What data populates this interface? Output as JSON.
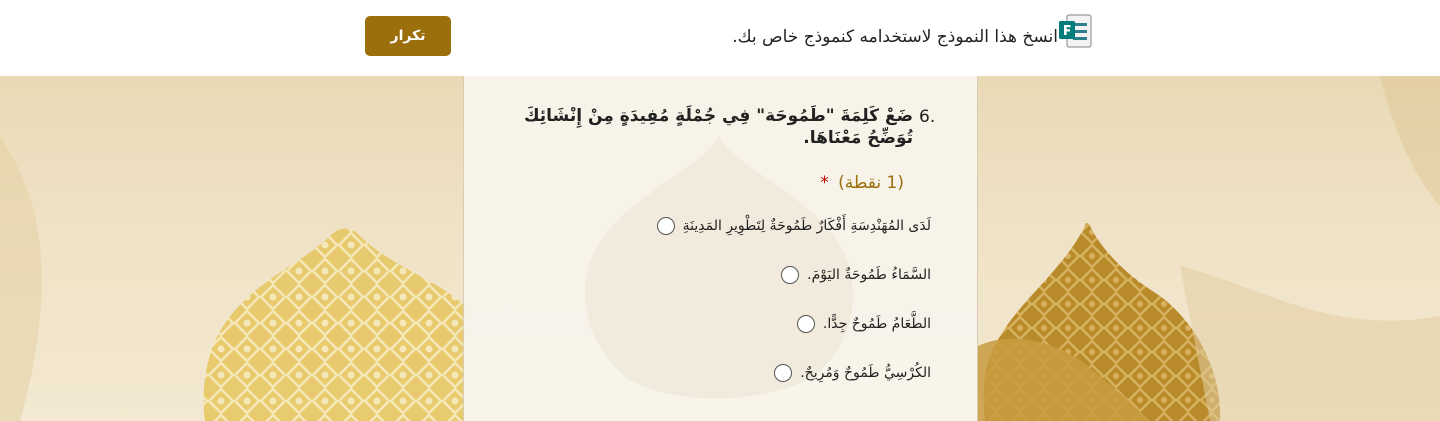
{
  "header": {
    "copy_text": "انسخ هذا النموذج لاستخدامه كنموذج خاص بك.",
    "repeat_label": "تكرار",
    "forms_icon": "microsoft-forms-icon"
  },
  "question": {
    "number": "6.",
    "title": "ضَعْ كَلِمَةَ \"طَمُوحَة\" فِي جُمْلَةٍ مُفِيدَةٍ مِنْ إِنْشَائِكَ تُوَضِّحُ مَعْنَاهَا.",
    "points": "(1 نقطة)",
    "required_mark": "*",
    "options": [
      "لَدَى المُهَنْدِسَةِ أَفْكَارٌ طَمُوحَةٌ لِتَطْوِيرِ المَدِينَةِ",
      "السَّمَاءُ طَمُوحَةٌ اليَوْمَ.",
      "الطَّعَامُ طَمُوحٌ جِدًّا.",
      "الكُرْسِيُّ طَمُوحٌ وَمُرِيحٌ."
    ]
  },
  "colors": {
    "accent": "#9a6f0c",
    "required": "#c00000",
    "background": "#efe3c8"
  }
}
